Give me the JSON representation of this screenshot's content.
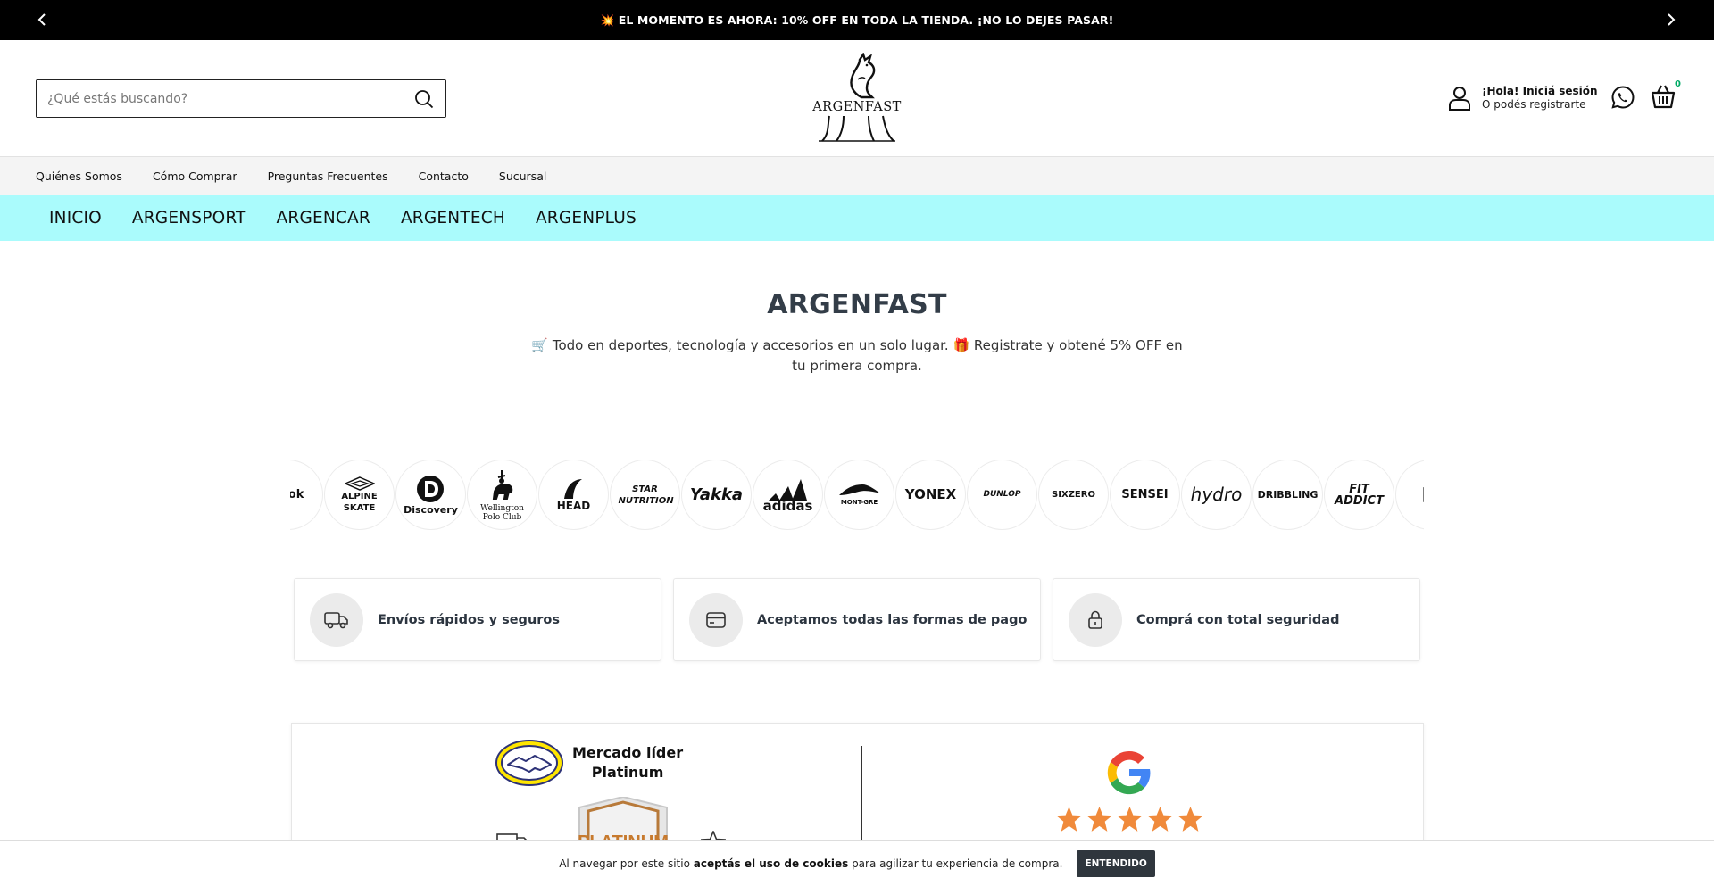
{
  "announcement": {
    "text": "💥 EL MOMENTO ES AHORA: 10% OFF EN TODA LA TIENDA. ¡NO LO DEJES PASAR!",
    "prev_icon": "chevron-left-icon",
    "next_icon": "chevron-right-icon"
  },
  "header": {
    "search_placeholder": "¿Qué estás buscando?",
    "logo_text": "ARGENFAST",
    "account_line1": "¡Hola! Iniciá sesión",
    "account_line2": "O podés registrarte",
    "cart_count": "0"
  },
  "subnav": {
    "items": [
      "Quiénes Somos",
      "Cómo Comprar",
      "Preguntas Frecuentes",
      "Contacto",
      "Sucursal"
    ]
  },
  "catnav": {
    "items": [
      "INICIO",
      "ARGENSPORT",
      "ARGENCAR",
      "ARGENTECH",
      "ARGENPLUS"
    ],
    "background": "#aafbfc"
  },
  "hero": {
    "title": "ARGENFAST",
    "subtitle": "🛒 Todo en deportes, tecnología y accesorios en un solo lugar. 🎁 Registrate y obtené 5% OFF en tu primera compra."
  },
  "brands": {
    "items": [
      "ebok",
      "ALPINE SKATE",
      "Discovery",
      "Wellington Polo Club",
      "HEAD",
      "STAR NUTRITION",
      "Yakka",
      "adidas",
      "MONT-GRE",
      "YONEX",
      "DUNLOP",
      "SIXZERO",
      "SENSEI",
      "hydro",
      "DRIBBLING",
      "FIT ADDICT",
      "⊠"
    ]
  },
  "features": {
    "items": [
      {
        "label": "Envíos rápidos y seguros",
        "icon": "truck-icon"
      },
      {
        "label": "Aceptamos todas las formas de pago",
        "icon": "credit-card-icon"
      },
      {
        "label": "Comprá con total seguridad",
        "icon": "lock-icon"
      }
    ]
  },
  "trust": {
    "ml_line1": "Mercado líder",
    "ml_line2": "Platinum",
    "platinum_text": "PLATINUM"
  },
  "cookie": {
    "text_before": "Al navegar por este sitio ",
    "text_bold": "aceptás el uso de cookies",
    "text_after": " para agilizar tu experiencia de compra.",
    "button": "ENTENDIDO"
  }
}
